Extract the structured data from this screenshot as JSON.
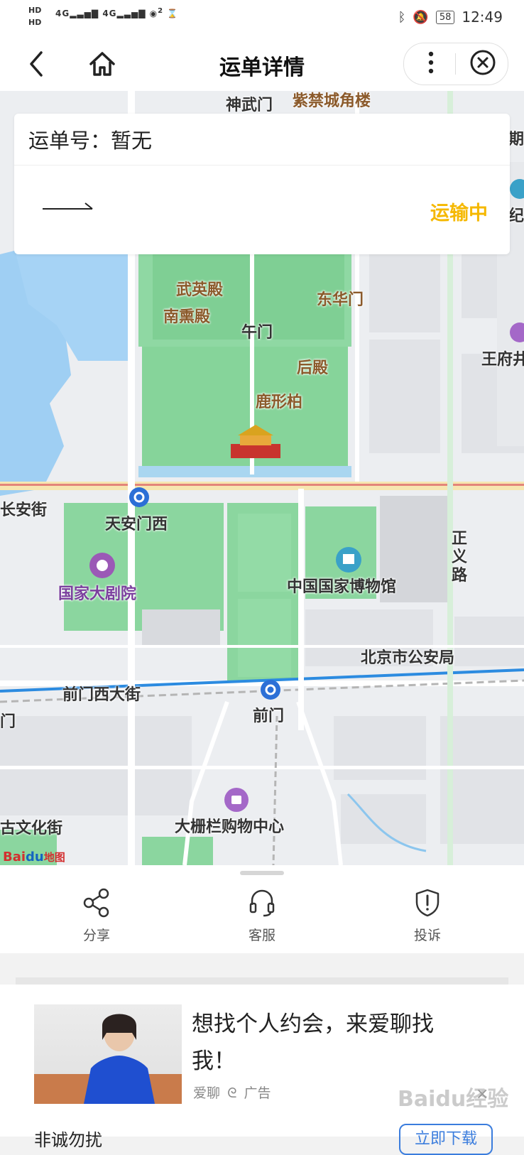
{
  "status_bar": {
    "hd1": "HD",
    "hd2": "HD",
    "net1": "4G",
    "net2": "4G",
    "wifi_sub": "2",
    "battery": "58",
    "time": "12:49"
  },
  "navbar": {
    "title": "运单详情"
  },
  "waybill": {
    "number_label": "运单号：暂无",
    "status": "运输中"
  },
  "map": {
    "labels": {
      "shenwumen": "神武门",
      "ziwuchengjiaolou": "紫禁城角楼",
      "wuyingdian": "武英殿",
      "nanxundian": "南熏殿",
      "donghuamen": "东华门",
      "wumen": "午门",
      "houdian": "后殿",
      "luxingbai": "鹿形柏",
      "wangfujing": "王府井",
      "changanjie": "长安街",
      "tiananmenxi": "天安门西",
      "guojiadajuyuan": "国家大剧院",
      "museum": "中国国家博物馆",
      "zhengyilu": "正义路",
      "gonganju": "北京市公安局",
      "qianmenxidajie": "前门西大街",
      "qianmen": "前门",
      "dashilan": "大栅栏购物中心",
      "guwenhuajie": "古文化街",
      "ji": "纪",
      "qi": "期",
      "men_left": "门"
    },
    "logo": "Bai",
    "logo_du": "du",
    "logo_suffix": "地图"
  },
  "actions": [
    {
      "label": "分享",
      "icon": "share-icon"
    },
    {
      "label": "客服",
      "icon": "headset-icon"
    },
    {
      "label": "投诉",
      "icon": "shield-alert-icon"
    }
  ],
  "ad": {
    "title": "想找个人约会，来爱聊找我！",
    "source": "爱聊",
    "ad_tag": "广告",
    "close": "×"
  },
  "bottom": {
    "text": "非诚勿扰",
    "button": "立即下载"
  },
  "watermark": "Baidu经验"
}
